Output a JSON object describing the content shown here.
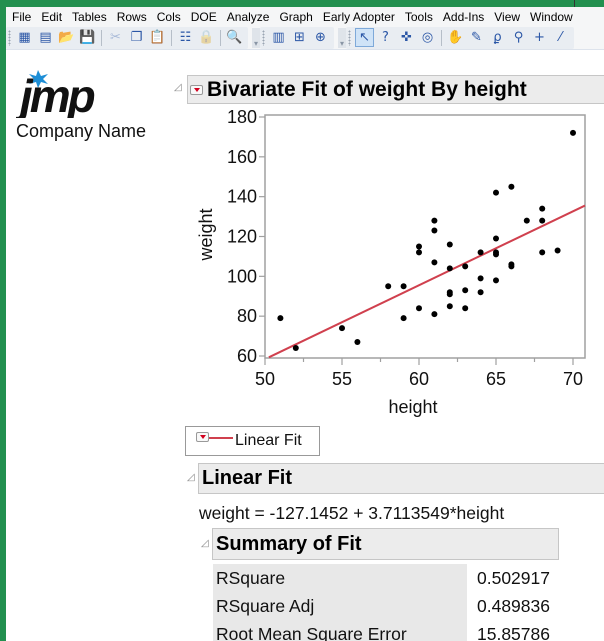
{
  "menubar": {
    "items": [
      "File",
      "Edit",
      "Tables",
      "Rows",
      "Cols",
      "DOE",
      "Analyze",
      "Graph",
      "Early Adopter",
      "Tools",
      "Add-Ins",
      "View",
      "Window"
    ]
  },
  "toolbar": {
    "groups": [
      [
        "new-data-table-icon",
        "new-script-icon",
        "open-folder-icon",
        "save-icon",
        "|",
        "cut-icon",
        "copy-icon",
        "paste-icon",
        "|",
        "preferences-icon",
        "lock-icon",
        "|",
        "search-icon"
      ],
      [
        "data-table-view-icon",
        "column-info-icon",
        "add-graph-icon"
      ],
      [
        "arrow-select-icon",
        "help-question-icon",
        "crosshair-icon",
        "target-icon",
        "|",
        "grabber-hand-icon",
        "brush-icon",
        "lasso-icon",
        "magnifier-icon",
        "plus-crosshair-icon",
        "ruler-icon"
      ]
    ],
    "selected": "arrow-select-icon"
  },
  "branding": {
    "logo_text": "jmp",
    "company_name": "Company Name"
  },
  "report": {
    "title": "Bivariate Fit of weight By height",
    "legend_label": "Linear Fit",
    "linear_fit_title": "Linear Fit",
    "equation": "weight = -127.1452 + 3.7113549*height",
    "summary_title": "Summary of Fit",
    "summary_rows": [
      {
        "label": "RSquare",
        "value": "0.502917"
      },
      {
        "label": "RSquare Adj",
        "value": "0.489836"
      },
      {
        "label": "Root Mean Square Error",
        "value": "15.85786"
      }
    ]
  },
  "chart_data": {
    "type": "scatter",
    "title": "",
    "xlabel": "height",
    "ylabel": "weight",
    "xlim": [
      50,
      71
    ],
    "ylim": [
      59,
      181
    ],
    "xticks": [
      50,
      55,
      60,
      65,
      70
    ],
    "yticks": [
      60,
      80,
      100,
      120,
      140,
      160,
      180
    ],
    "grid": false,
    "colors": {
      "points": "#000000",
      "fit_line": "#d0404e",
      "frame": "#a0a0a0"
    },
    "points": [
      [
        51,
        79
      ],
      [
        52,
        64
      ],
      [
        55,
        74
      ],
      [
        56,
        67
      ],
      [
        58,
        95
      ],
      [
        59,
        95
      ],
      [
        59,
        79
      ],
      [
        60,
        115
      ],
      [
        60,
        112
      ],
      [
        60,
        84
      ],
      [
        61,
        128
      ],
      [
        61,
        123
      ],
      [
        61,
        107
      ],
      [
        61,
        81
      ],
      [
        62,
        116
      ],
      [
        62,
        104
      ],
      [
        62,
        92
      ],
      [
        62,
        91
      ],
      [
        62,
        85
      ],
      [
        63,
        105
      ],
      [
        63,
        93
      ],
      [
        63,
        84
      ],
      [
        64,
        112
      ],
      [
        64,
        99
      ],
      [
        64,
        92
      ],
      [
        65,
        142
      ],
      [
        65,
        119
      ],
      [
        65,
        112
      ],
      [
        65,
        111
      ],
      [
        65,
        98
      ],
      [
        66,
        145
      ],
      [
        66,
        106
      ],
      [
        66,
        105
      ],
      [
        67,
        128
      ],
      [
        68,
        134
      ],
      [
        68,
        128
      ],
      [
        68,
        112
      ],
      [
        69,
        113
      ],
      [
        70,
        172
      ]
    ],
    "fit": {
      "name": "Linear Fit",
      "intercept": -127.1452,
      "slope": 3.7113549
    }
  }
}
